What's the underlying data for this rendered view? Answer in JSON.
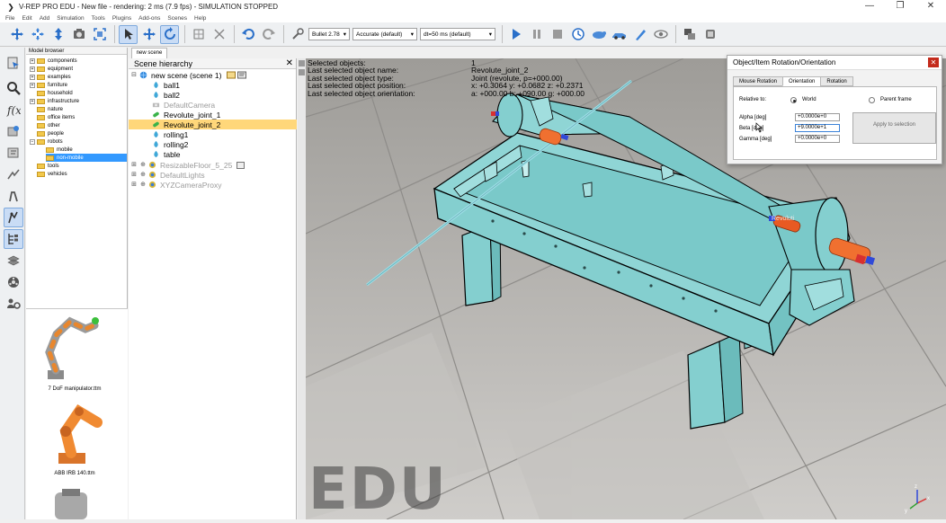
{
  "window": {
    "title": "V-REP PRO EDU - New file - rendering: 2 ms (7.9 fps) - SIMULATION STOPPED"
  },
  "menu": [
    "File",
    "Edit",
    "Add",
    "Simulation",
    "Tools",
    "Plugins",
    "Add-ons",
    "Scenes",
    "Help"
  ],
  "toolbar": {
    "engine": "Bullet 2.78",
    "accuracy": "Accurate (default)",
    "timestep": "dt=50 ms (default)"
  },
  "model_browser": {
    "header": "Model browser",
    "folders": [
      "components",
      "equipment",
      "examples",
      "furniture",
      "household",
      "infrastructure",
      "nature",
      "office items",
      "other",
      "people",
      "robots",
      "mobile",
      "non-mobile",
      "tools",
      "vehicles"
    ],
    "thumbs": [
      "7 DoF manipulator.ttm",
      "ABB IRB 140.ttm"
    ]
  },
  "scene_tab": "new scene",
  "hierarchy": {
    "title": "Scene hierarchy",
    "root": "new scene (scene 1)",
    "items": [
      "ball1",
      "ball2",
      "DefaultCamera",
      "Revolute_joint_1",
      "Revolute_joint_2",
      "rolling1",
      "rolling2",
      "table",
      "ResizableFloor_5_25",
      "DefaultLights",
      "XYZCameraProxy"
    ]
  },
  "info": {
    "rows": [
      {
        "k": "Selected objects:",
        "v": "1"
      },
      {
        "k": "Last selected object name:",
        "v": "Revolute_joint_2"
      },
      {
        "k": "Last selected object type:",
        "v": "Joint (revolute, p=+000.00)"
      },
      {
        "k": "Last selected object position:",
        "v": "x: +0.3064   y: +0.0682   z: +0.2371"
      },
      {
        "k": "Last selected object orientation:",
        "v": "a: +000.00   b: +090.00   g: +000.00"
      }
    ]
  },
  "viewport_watermark": "EDU",
  "joint_label": "Revoluti",
  "dialog": {
    "title": "Object/Item Rotation/Orientation",
    "tabs": [
      "Mouse Rotation",
      "Orientation",
      "Rotation"
    ],
    "relative_to": "Relative to:",
    "world": "World",
    "parent": "Parent frame",
    "alpha_label": "Alpha [deg]",
    "beta_label": "Beta [deg]",
    "gamma_label": "Gamma [deg]",
    "alpha": "+0.0000e+0",
    "beta": "+9.0000e+1",
    "gamma": "+0.0000e+0",
    "apply": "Apply to selection"
  },
  "colors": {
    "table": "#84cfcf",
    "selection": "#ffd77a",
    "cylinder": "#f07030"
  }
}
